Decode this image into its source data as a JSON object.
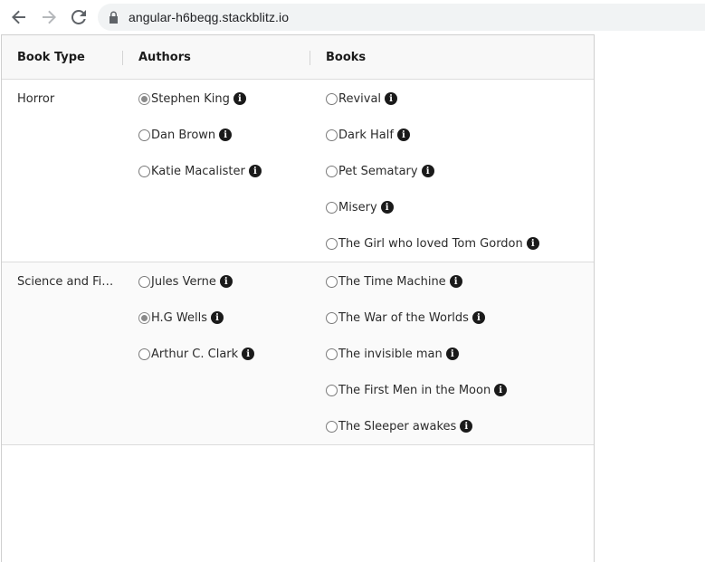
{
  "browser": {
    "url": "angular-h6beqg.stackblitz.io"
  },
  "grid": {
    "headers": {
      "book_type": "Book Type",
      "authors": "Authors",
      "books": "Books"
    },
    "rows": [
      {
        "type": "Horror",
        "authors": [
          {
            "name": "Stephen King",
            "checked": true
          },
          {
            "name": "Dan Brown",
            "checked": false
          },
          {
            "name": "Katie Macalister",
            "checked": false
          }
        ],
        "books": [
          {
            "name": "Revival",
            "checked": false
          },
          {
            "name": "Dark Half",
            "checked": false
          },
          {
            "name": "Pet Sematary",
            "checked": false
          },
          {
            "name": "Misery",
            "checked": false
          },
          {
            "name": "The Girl who loved Tom Gordon",
            "checked": false
          }
        ]
      },
      {
        "type": "Science and Fi…",
        "authors": [
          {
            "name": "Jules Verne",
            "checked": false
          },
          {
            "name": "H.G Wells",
            "checked": true
          },
          {
            "name": "Arthur C. Clark",
            "checked": false
          }
        ],
        "books": [
          {
            "name": "The Time Machine",
            "checked": false
          },
          {
            "name": "The War of the Worlds",
            "checked": false
          },
          {
            "name": "The invisible man",
            "checked": false
          },
          {
            "name": "The First Men in the Moon",
            "checked": false
          },
          {
            "name": "The Sleeper awakes",
            "checked": false
          }
        ]
      }
    ]
  },
  "icons": {
    "back": "arrow-left-icon",
    "forward": "arrow-right-icon",
    "reload": "reload-icon",
    "lock": "lock-icon",
    "info": "info-icon"
  }
}
